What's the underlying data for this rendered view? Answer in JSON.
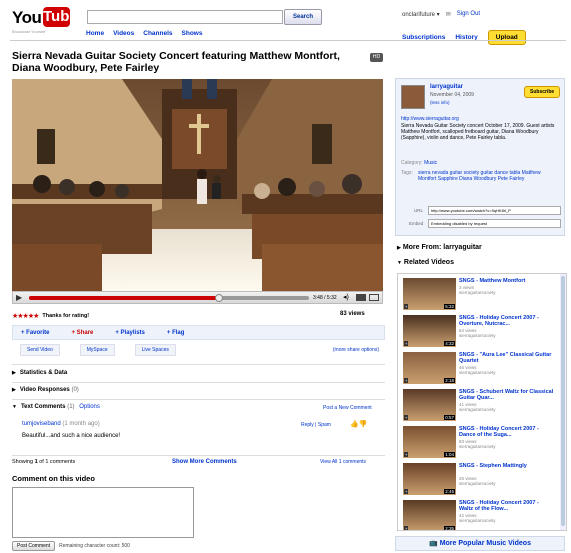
{
  "header": {
    "logo_you": "You",
    "logo_tube": "Tube",
    "logo_sub": "Broadcast Yourself",
    "search_button": "Search",
    "nav": [
      "Home",
      "Videos",
      "Channels",
      "Shows"
    ],
    "username": "onclarifuture ▾",
    "sign_out": "Sign Out",
    "subscriptions": "Subscriptions",
    "history": "History",
    "upload": "Upload"
  },
  "video": {
    "title": "Sierra Nevada Guitar Society Concert featuring Matthew Montfort, Diana Woodbury, Pete Fairley",
    "time": "3:48 / 5:32",
    "hd_icon": "HD"
  },
  "rating": {
    "stars": "★★★★★",
    "thanks": "Thanks for rating!",
    "views": "83 views"
  },
  "actions": {
    "favorite": "+ Favorite",
    "share": "+ Share",
    "playlists": "+ Playlists",
    "flag": "+ Flag"
  },
  "share": {
    "send": "Send Video",
    "myspace": "MySpace",
    "live": "Live Spaces",
    "more": "(more share options)"
  },
  "sections": {
    "stats": "Statistics & Data",
    "responses": "Video Responses",
    "responses_count": "(0)",
    "comments": "Text Comments",
    "comments_count": "(1)",
    "options": "Options",
    "post_new": "Post a New Comment"
  },
  "comment": {
    "author": "tumjoviseband",
    "when": "(1 month ago)",
    "reply": "Reply | Spam",
    "text": "Beautiful...and such a nice audience!"
  },
  "paging": {
    "showing": "Showing",
    "showing_count": "1",
    "showing_tail": "of 1 comments",
    "show_more": "Show More Comments",
    "view_all": "View All 1 comments"
  },
  "comment_form": {
    "heading": "Comment on this video",
    "post": "Post Comment",
    "remaining": "Remaining character count: 500"
  },
  "uploader": {
    "name": "larryaguitar",
    "date": "November 04, 2009",
    "see_info": "(less info)",
    "subscribe": "Subscribe",
    "url": "http://www.sierraguitar.org",
    "desc": "Sierra Nevada Guitar Society concert October 17, 2009. Guest artists Matthew Montfort, scalloped fretboard guitar, Diana Woodbury (Sapphire), violin and dance, Pete Fairley tabla.",
    "category_label": "Category:",
    "category": "Music",
    "tags_label": "Tags:",
    "tags": "sierra nevada guitar society guitar dance tabla Matthew Montfort Sapphire Diana Woodbury Pete Fairley",
    "url_label": "URL",
    "url_value": "http://www.youtube.com/watch?v=9qHK8rl_P",
    "embed_label": "Embed",
    "embed_value": "Embedding disabled by request"
  },
  "sidebar": {
    "more_from": "More From: larryaguitar",
    "related": "Related Videos",
    "more_popular": "More Popular Music Videos",
    "items": [
      {
        "title": "SNGS - Matthew Montfort",
        "views": "3 views",
        "user": "sierraguitarsociety",
        "duration": "5:32"
      },
      {
        "title": "SNGS - Holiday Concert 2007 - Overture, Nutcrac...",
        "views": "64 views",
        "user": "sierraguitarsociety",
        "duration": "4:32"
      },
      {
        "title": "SNGS - \"Aura Lee\" Classical Guitar Quartet",
        "views": "46 views",
        "user": "sierraguitarsociety",
        "duration": "2:18"
      },
      {
        "title": "SNGS - Schubert Waltz for Classical Guitar Quar...",
        "views": "41 views",
        "user": "sierraguitarsociety",
        "duration": "0:57"
      },
      {
        "title": "SNGS - Holiday Concert 2007 - Dance of the Suga...",
        "views": "83 views",
        "user": "sierraguitarsociety",
        "duration": "1:04"
      },
      {
        "title": "SNGS - Stephen Mattingly",
        "views": "25 views",
        "user": "sierraguitarsociety",
        "duration": "2:45"
      },
      {
        "title": "SNGS - Holiday Concert 2007 - Waltz of the Flow...",
        "views": "42 views",
        "user": "sierraguitarsociety",
        "duration": "2:35"
      }
    ]
  }
}
